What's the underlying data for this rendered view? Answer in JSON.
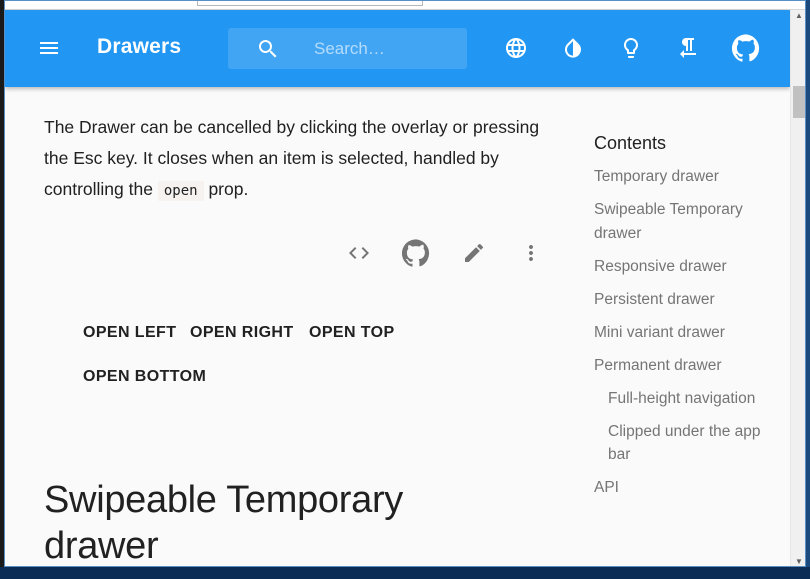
{
  "appbar": {
    "title": "Drawers",
    "search_placeholder": "Search…",
    "icons": [
      "menu-icon",
      "search-icon",
      "language-icon",
      "invert-colors-icon",
      "lightbulb-icon",
      "format-textdirection-icon",
      "github-icon"
    ],
    "color": "#2196f3"
  },
  "content": {
    "paragraph_part1": "The Drawer can be cancelled by clicking the overlay or pressing the Esc key. It closes when an item is selected, handled by controlling the",
    "paragraph_code": "open",
    "paragraph_part2": "prop.",
    "demo_toolbar_icons": [
      "code-icon",
      "github-icon",
      "edit-icon",
      "more-vert-icon"
    ],
    "buttons": {
      "open_left": "OPEN LEFT",
      "open_right": "OPEN RIGHT",
      "open_top": "OPEN TOP",
      "open_bottom": "OPEN BOTTOM"
    },
    "section_heading": "Swipeable Temporary drawer"
  },
  "toc": {
    "title": "Contents",
    "items": [
      {
        "label": "Temporary drawer"
      },
      {
        "label": "Swipeable Temporary drawer"
      },
      {
        "label": "Responsive drawer"
      },
      {
        "label": "Persistent drawer"
      },
      {
        "label": "Mini variant drawer"
      },
      {
        "label": "Permanent drawer"
      },
      {
        "label": "Full-height navigation"
      },
      {
        "label": "Clipped under the app bar"
      },
      {
        "label": "API"
      }
    ]
  }
}
